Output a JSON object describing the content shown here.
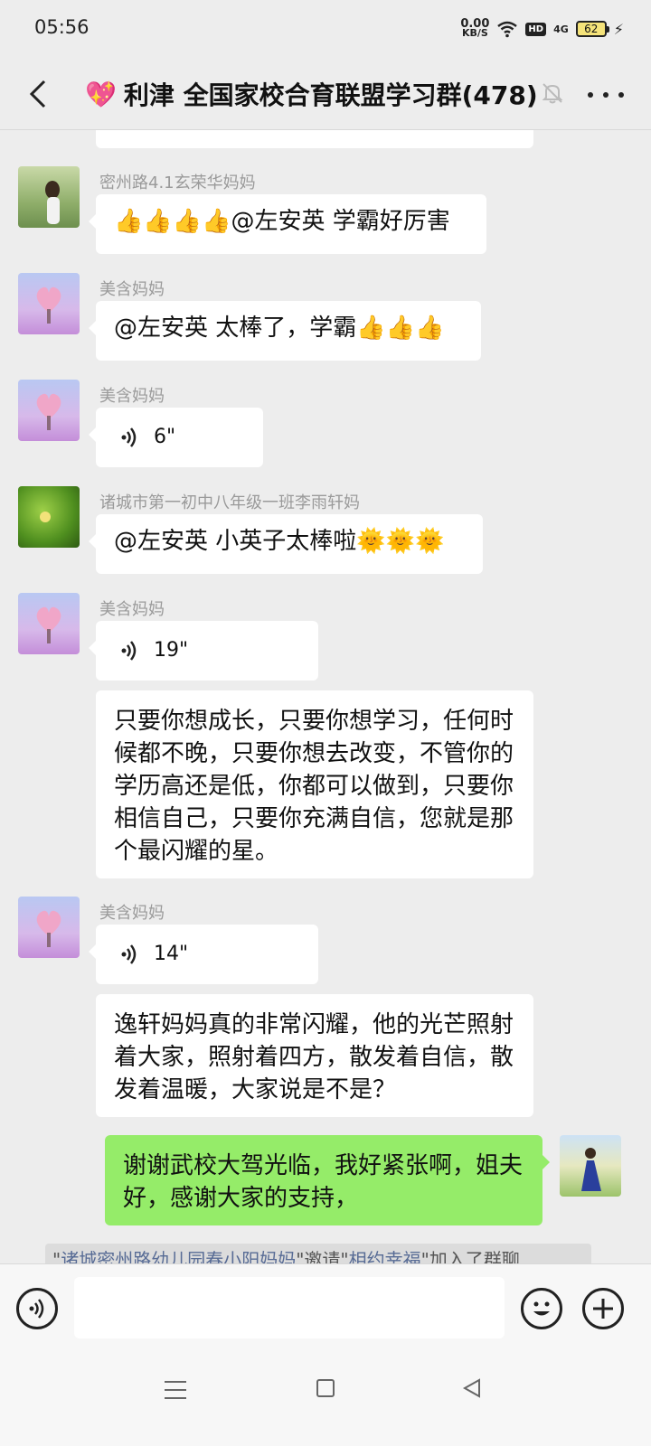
{
  "status_bar": {
    "time": "05:56",
    "net_speed_value": "0.00",
    "net_speed_unit": "KB/S",
    "hd": "HD",
    "signal": "4G",
    "battery": "62"
  },
  "header": {
    "title_emoji": "💖",
    "title": "利津 全国家校合育联盟学习群(478)"
  },
  "messages": [
    {
      "sender": "密州路4.1玄荣华妈妈",
      "text": "👍👍👍👍@左安英  学霸好厉害"
    },
    {
      "sender": "美含妈妈",
      "text": "@左安英  太棒了，学霸👍👍👍"
    },
    {
      "sender": "美含妈妈",
      "voice_duration": "6\""
    },
    {
      "sender": "诸城市第一初中八年级一班李雨轩妈",
      "text": "@左安英  小英子太棒啦🌞🌞🌞"
    },
    {
      "sender": "美含妈妈",
      "voice_duration": "19\""
    },
    {
      "text": "只要你想成长，只要你想学习，任何时候都不晚，只要你想去改变，不管你的学历高还是低，你都可以做到，只要你相信自己，只要你充满自信，您就是那个最闪耀的星。"
    },
    {
      "sender": "美含妈妈",
      "voice_duration": "14\""
    },
    {
      "text": "逸轩妈妈真的非常闪耀，他的光芒照射着大家，照射着四方，散发着自信，散发着温暖，大家说是不是？"
    },
    {
      "text": "谢谢武校大驾光临，我好紧张啊，姐夫好，感谢大家的支持，"
    }
  ],
  "system_note": {
    "quote_open": "\"",
    "inviter": "诸城密州路幼儿园春小阳妈妈",
    "mid": "\"邀请\"",
    "invitee": "相约幸福",
    "end": "\"加入了群聊"
  },
  "colors": {
    "self_bubble": "#95ec69",
    "other_bubble": "#ffffff",
    "background": "#ededed",
    "link": "#576b95"
  },
  "icons": [
    "back-icon",
    "mute-icon",
    "more-icon",
    "voice-icon",
    "emoji-icon",
    "plus-icon"
  ]
}
